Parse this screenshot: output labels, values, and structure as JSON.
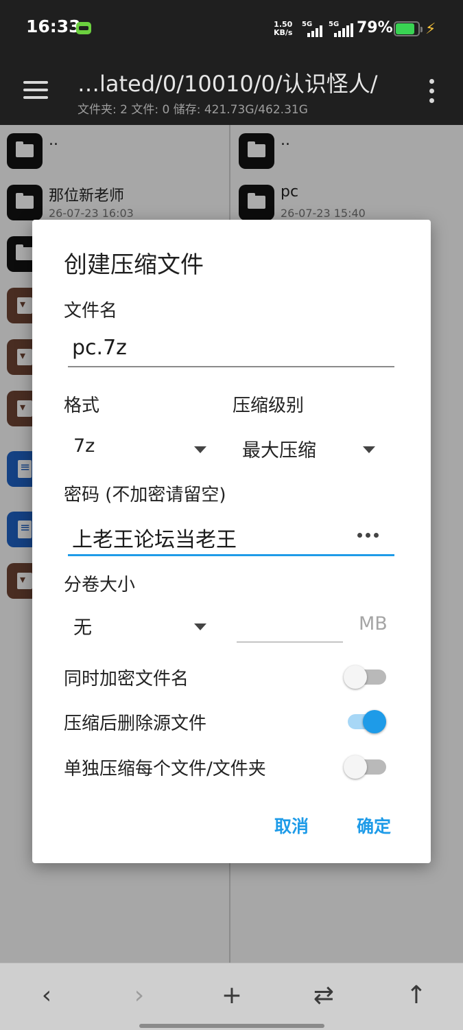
{
  "status_bar": {
    "time": "16:33",
    "net_speed_value": "1.50",
    "net_speed_unit": "KB/s",
    "signal_1": "5G",
    "signal_2": "5G",
    "battery_percent": "79%"
  },
  "app_bar": {
    "path": "…lated/0/10010/0/认识怪人/",
    "info": "文件夹: 2  文件: 0  储存: 421.73G/462.31G"
  },
  "left_pane": {
    "items": [
      {
        "name": "..",
        "date": "",
        "type": "folder"
      },
      {
        "name": "那位新老师",
        "date": "26-07-23 16:03",
        "type": "folder"
      },
      {
        "name": "",
        "date": "",
        "type": "folder"
      },
      {
        "name": "",
        "date": "",
        "type": "archive"
      },
      {
        "name": "",
        "date": "",
        "type": "archive"
      },
      {
        "name": "",
        "date": "",
        "type": "archive"
      },
      {
        "name": "",
        "date": "",
        "type": "document"
      },
      {
        "name": "",
        "date": "",
        "type": "document"
      },
      {
        "name": "",
        "date": "",
        "type": "archive"
      }
    ]
  },
  "right_pane": {
    "items": [
      {
        "name": "..",
        "date": "",
        "type": "folder"
      },
      {
        "name": "pc",
        "date": "26-07-23 15:40",
        "type": "folder"
      }
    ]
  },
  "dialog": {
    "title": "创建压缩文件",
    "filename_label": "文件名",
    "filename_value": "pc.7z",
    "format_label": "格式",
    "format_value": "7z",
    "level_label": "压缩级别",
    "level_value": "最大压缩",
    "password_label": "密码 (不加密请留空)",
    "password_value": "上老王论坛当老王",
    "volume_label": "分卷大小",
    "volume_value": "无",
    "volume_size_value": "",
    "volume_unit": "MB",
    "options": [
      {
        "label": "同时加密文件名",
        "on": false
      },
      {
        "label": "压缩后删除源文件",
        "on": true
      },
      {
        "label": "单独压缩每个文件/文件夹",
        "on": false
      }
    ],
    "cancel_label": "取消",
    "ok_label": "确定"
  },
  "icons": {
    "menu": "hamburger-menu-icon",
    "overflow": "more-vertical-icon",
    "back": "chevron-left-icon",
    "forward": "chevron-right-icon",
    "add": "plus-icon",
    "swap": "swap-arrows-icon",
    "up": "arrow-up-icon"
  },
  "colors": {
    "accent": "#1e9be8",
    "archive_icon": "#6d4434",
    "document_icon": "#1f62c4",
    "header_bg": "#1f1f1f"
  }
}
